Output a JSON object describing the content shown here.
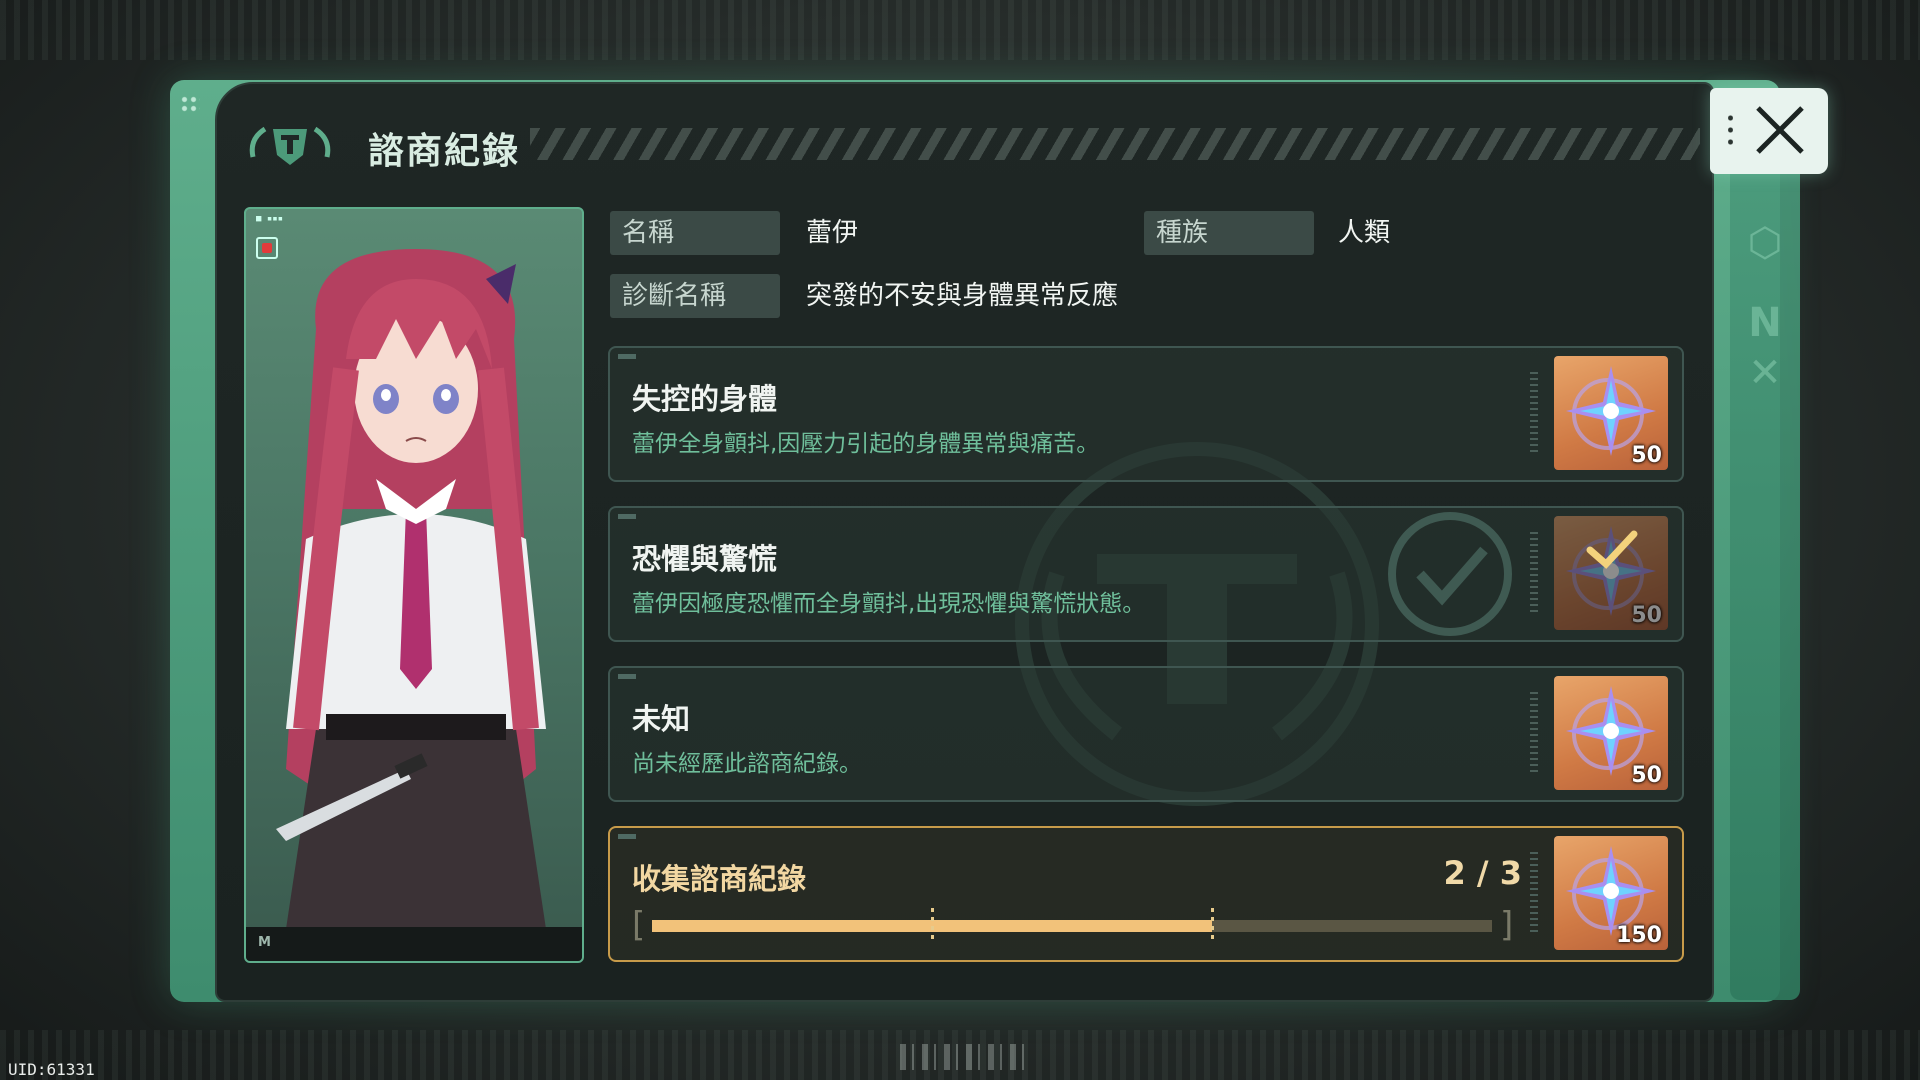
{
  "dialog": {
    "title": "諮商紀錄",
    "close_label": "×"
  },
  "info": {
    "name_label": "名稱",
    "name_value": "蕾伊",
    "race_label": "種族",
    "race_value": "人類",
    "diagnosis_label": "診斷名稱",
    "diagnosis_value": "突發的不安與身體異常反應"
  },
  "records": [
    {
      "title": "失控的身體",
      "description": "蕾伊全身顫抖,因壓力引起的身體異常與痛苦。",
      "reward_icon": "crystal-star-icon",
      "reward_amount": "50",
      "claimed": false
    },
    {
      "title": "恐懼與驚慌",
      "description": "蕾伊因極度恐懼而全身顫抖,出現恐懼與驚慌狀態。",
      "reward_icon": "crystal-star-icon",
      "reward_amount": "50",
      "claimed": true
    },
    {
      "title": "未知",
      "description": "尚未經歷此諮商紀錄。",
      "reward_icon": "crystal-star-icon",
      "reward_amount": "50",
      "claimed": false
    }
  ],
  "collection": {
    "title": "收集諮商紀錄",
    "count_text": "2 / 3",
    "progress": 0.667,
    "milestones": 3,
    "reward_icon": "crystal-star-icon",
    "reward_amount": "150"
  },
  "footer": {
    "uid": "UID:61331"
  },
  "colors": {
    "frame_green": "#5fae8c",
    "panel_dark": "#1f2725",
    "desc_green": "#6fbf9b",
    "progress_gold": "#f2c27a",
    "reward_orange": "#d07a45"
  }
}
